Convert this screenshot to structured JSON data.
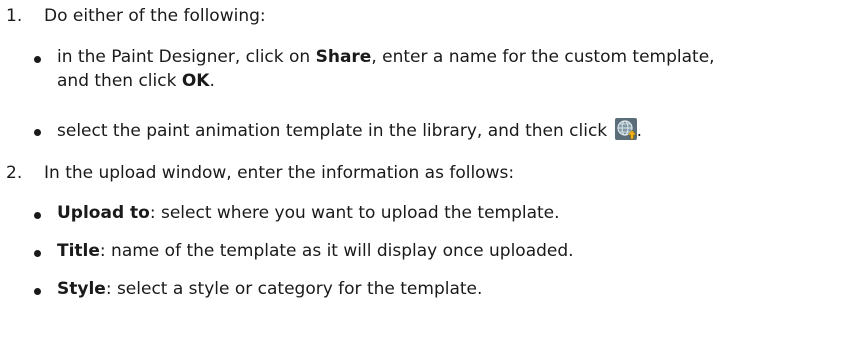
{
  "steps": [
    {
      "number": "1.",
      "text": "Do either of the following:",
      "bullets": [
        {
          "pre": "in the Paint Designer, click on ",
          "bold1": "Share",
          "mid": ", enter a name for the custom template,",
          "line2_pre": "and then click ",
          "bold2": "OK",
          "line2_post": "."
        },
        {
          "pre": "select the paint animation template in the library, and then click ",
          "icon": "upload-globe-icon",
          "post": "."
        }
      ]
    },
    {
      "number": "2.",
      "text": "In the upload window, enter the information as follows:",
      "bullets": [
        {
          "bold": "Upload to",
          "rest": ": select where you want to upload the template."
        },
        {
          "bold": "Title",
          "rest": ": name of the template as it will display once uploaded."
        },
        {
          "bold": "Style",
          "rest": ": select a style or category for the template."
        }
      ]
    }
  ]
}
